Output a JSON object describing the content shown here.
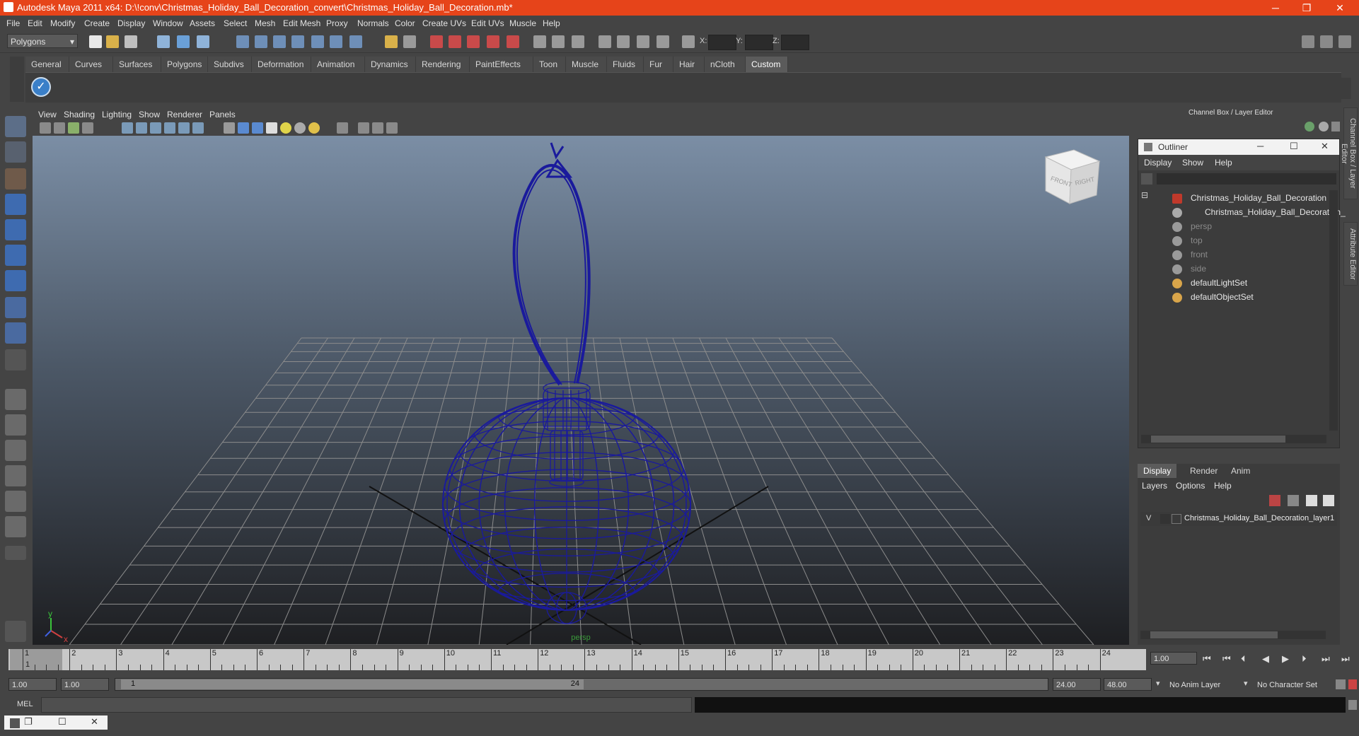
{
  "window": {
    "title": "Autodesk Maya 2011 x64: D:\\!conv\\Christmas_Holiday_Ball_Decoration_convert\\Christmas_Holiday_Ball_Decoration.mb*",
    "minimize": "─",
    "restore": "❐",
    "close": "✕"
  },
  "menus": [
    "File",
    "Edit",
    "Modify",
    "Create",
    "Display",
    "Window",
    "Assets",
    "Select",
    "Mesh",
    "Edit Mesh",
    "Proxy",
    "Normals",
    "Color",
    "Create UVs",
    "Edit UVs",
    "Muscle",
    "Help"
  ],
  "statusline": {
    "mode": "Polygons",
    "x_label": "X:",
    "y_label": "Y:",
    "z_label": "Z:"
  },
  "shelf": {
    "tabs": [
      "General",
      "Curves",
      "Surfaces",
      "Polygons",
      "Subdivs",
      "Deformation",
      "Animation",
      "Dynamics",
      "Rendering",
      "PaintEffects",
      "Toon",
      "Muscle",
      "Fluids",
      "Fur",
      "Hair",
      "nCloth",
      "Custom"
    ],
    "active": "Custom"
  },
  "panel": {
    "menus": [
      "View",
      "Shading",
      "Lighting",
      "Show",
      "Renderer",
      "Panels"
    ],
    "camera": "persp",
    "axis_y": "y",
    "axis_x": "x",
    "viewcube_front": "FRONT",
    "viewcube_right": "RIGHT"
  },
  "channelbox": {
    "title": "Channel Box / Layer Editor",
    "side_tab_1": "Channel Box / Layer Editor",
    "side_tab_2": "Attribute Editor"
  },
  "outliner": {
    "title": "Outliner",
    "menus": [
      "Display",
      "Show",
      "Help"
    ],
    "items": [
      {
        "label": "Christmas_Holiday_Ball_Decoration",
        "dim": false
      },
      {
        "label": "Christmas_Holiday_Ball_Decoration_",
        "dim": false
      },
      {
        "label": "persp",
        "dim": true
      },
      {
        "label": "top",
        "dim": true
      },
      {
        "label": "front",
        "dim": true
      },
      {
        "label": "side",
        "dim": true
      },
      {
        "label": "defaultLightSet",
        "dim": false
      },
      {
        "label": "defaultObjectSet",
        "dim": false
      }
    ],
    "expand_symbol": "⊟"
  },
  "layers": {
    "tabs": [
      "Display",
      "Render",
      "Anim"
    ],
    "active_tab": "Display",
    "menus": [
      "Layers",
      "Options",
      "Help"
    ],
    "layer_visible": "V",
    "layer_name": "Christmas_Holiday_Ball_Decoration_layer1"
  },
  "timeline": {
    "ticks": [
      "1",
      "2",
      "3",
      "4",
      "5",
      "6",
      "7",
      "8",
      "9",
      "10",
      "11",
      "12",
      "13",
      "14",
      "15",
      "16",
      "17",
      "18",
      "19",
      "20",
      "21",
      "22",
      "23",
      "24"
    ],
    "current_frame_marker": "1",
    "current_time": "1.00"
  },
  "range": {
    "start_time": "1.00",
    "playback_start": "1.00",
    "range_start_label": "1",
    "range_end_label": "24",
    "playback_end": "24.00",
    "end_time": "48.00",
    "anim_layer": "No Anim Layer",
    "character_set": "No Character Set"
  },
  "cmdline": {
    "label": "MEL"
  },
  "colors": {
    "titlebar": "#e6441a",
    "wireframe": "#1a1a9c",
    "grid": "#8c8c8c"
  }
}
